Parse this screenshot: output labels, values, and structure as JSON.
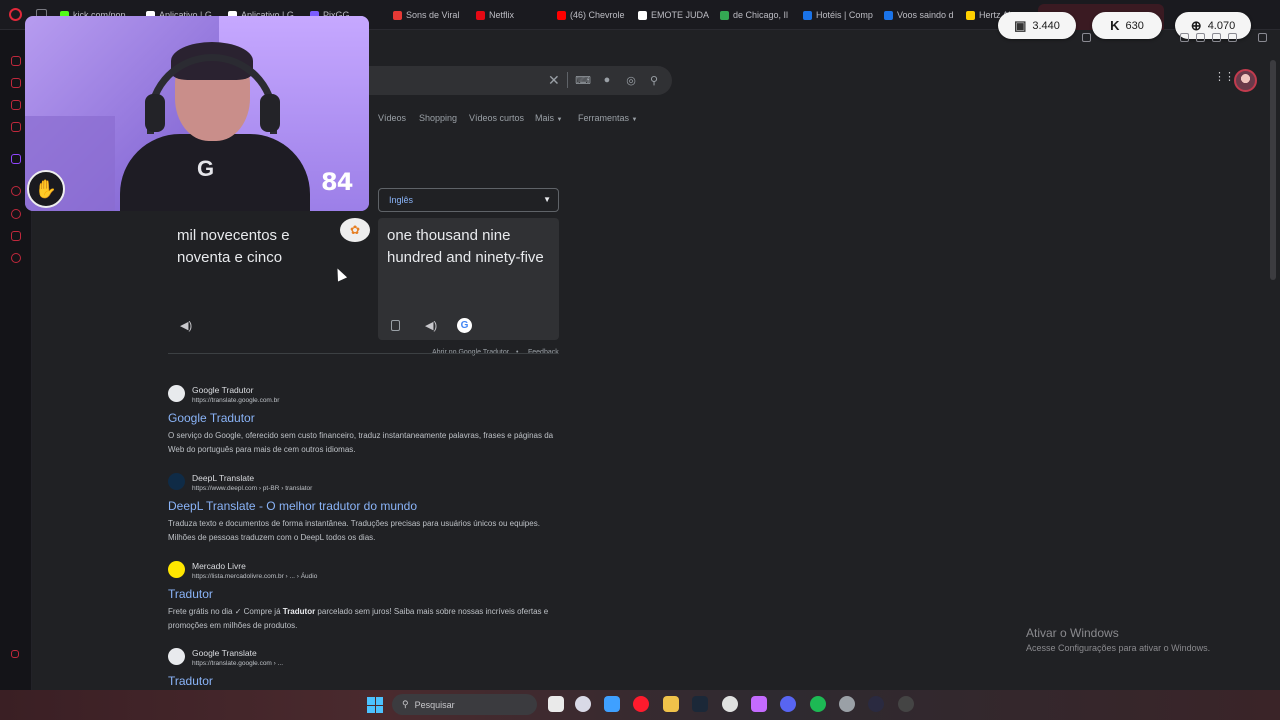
{
  "browser": {
    "tabs": [
      {
        "label": "kick.com/pop",
        "color": "#53fc18"
      },
      {
        "label": "Aplicativo | G",
        "color": "#ffffff"
      },
      {
        "label": "Aplicativo | G",
        "color": "#ffffff"
      },
      {
        "label": "PixGG",
        "color": "#7b5cff"
      },
      {
        "label": "Sons de Viral",
        "color": "#e53935"
      },
      {
        "label": "Netflix",
        "color": "#e50914"
      },
      {
        "label": "(46) Chevrole",
        "color": "#ff0000"
      },
      {
        "label": "EMOTE JUDA",
        "color": "#ffffff"
      },
      {
        "label": "de Chicago, Il",
        "color": "#34a853"
      },
      {
        "label": "Hotéis | Comp",
        "color": "#1a73e8"
      },
      {
        "label": "Voos saindo d",
        "color": "#1a73e8"
      },
      {
        "label": "Hertz Al",
        "color": "#ffd000"
      }
    ]
  },
  "overlay": {
    "twitch_count": "3.440",
    "kick_count": "630",
    "web_count": "4.070",
    "cam_number": "84"
  },
  "search": {
    "clear": "✕"
  },
  "nav": {
    "items": [
      "Vídeos",
      "Shopping",
      "Vídeos curtos",
      "Mais",
      "Ferramentas"
    ]
  },
  "translator": {
    "target_language": "Inglês",
    "source_text": "mil novecentos e noventa e cinco",
    "translated_text": "one thousand nine hundred and ninety-five",
    "open_link": "Abrir no Google Tradutor",
    "separator": "•",
    "feedback": "Feedback"
  },
  "results": [
    {
      "site": "Google Tradutor",
      "url": "https://translate.google.com.br",
      "title": "Google Tradutor",
      "snippet": "O serviço do Google, oferecido sem custo financeiro, traduz instantaneamente palavras, frases e páginas da Web do português para mais de cem outros idiomas."
    },
    {
      "site": "DeepL Translate",
      "url": "https://www.deepl.com › pt-BR › translator",
      "title": "DeepL Translate - O melhor tradutor do mundo",
      "snippet": "Traduza texto e documentos de forma instantânea. Traduções precisas para usuários únicos ou equipes. Milhões de pessoas traduzem com o DeepL todos os dias."
    },
    {
      "site": "Mercado Livre",
      "url": "https://lista.mercadolivre.com.br › ... › Áudio",
      "title": "Tradutor",
      "snippet_pre": "Frete grátis no dia ✓ Compre já ",
      "snippet_bold": "Tradutor",
      "snippet_post": " parcelado sem juros! Saiba mais sobre nossas incríveis ofertas e promoções em milhões de produtos."
    },
    {
      "site": "Google Translate",
      "url": "https://translate.google.com › ...",
      "title": "Tradutor"
    }
  ],
  "windows_activation": {
    "title": "Ativar o Windows",
    "subtitle": "Acesse Configurações para ativar o Windows."
  },
  "taskbar": {
    "search_placeholder": "Pesquisar"
  }
}
